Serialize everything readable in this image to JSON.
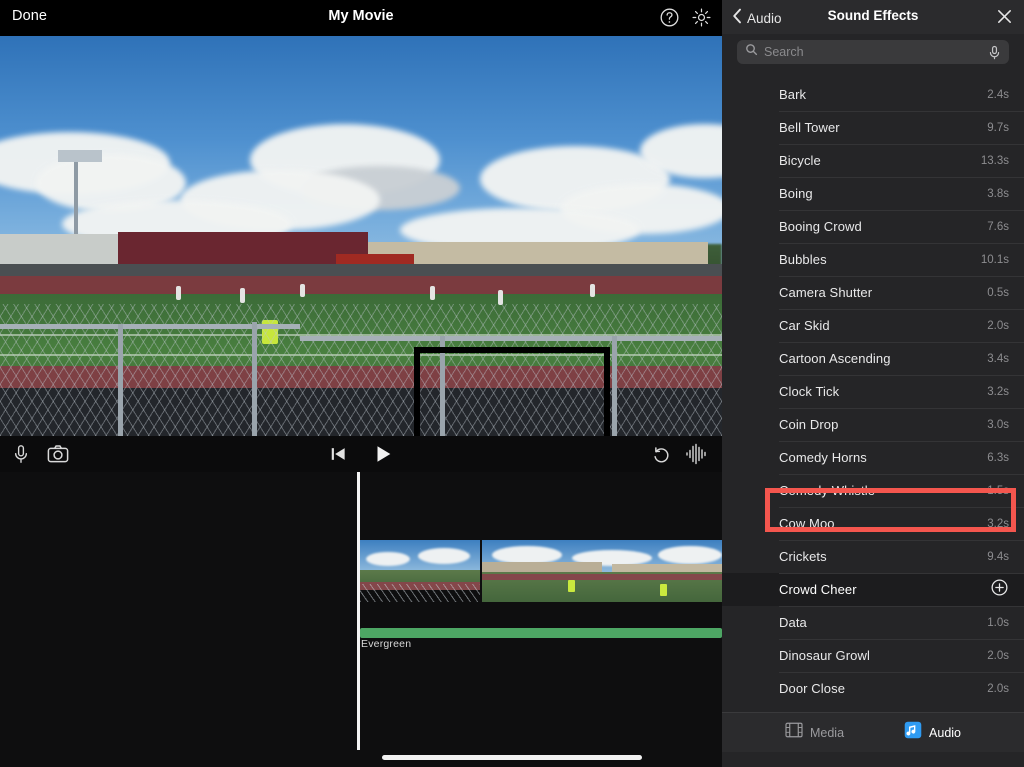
{
  "editor": {
    "toolbar": {
      "done_label": "Done",
      "project_title": "My Movie",
      "help_icon": "question-circle-icon",
      "settings_icon": "gear-icon"
    },
    "controls": {
      "mic_icon": "microphone-icon",
      "camera_icon": "camera-icon",
      "skip_start_icon": "skip-to-start-icon",
      "play_icon": "play-icon",
      "undo_icon": "undo-icon",
      "waveform_icon": "audio-waveform-icon"
    },
    "timeline": {
      "audio_track_label": "Evergreen",
      "audio_track_color": "#4da664",
      "playhead_color": "#f4f4f4"
    },
    "preview": {
      "annotation_box_color": "#000000"
    }
  },
  "panel": {
    "back_label": "Audio",
    "back_icon": "chevron-left-icon",
    "title": "Sound Effects",
    "close_icon": "close-icon",
    "search": {
      "placeholder": "Search",
      "value": "",
      "search_icon": "search-icon",
      "mic_icon": "microphone-icon"
    },
    "highlight_color": "#f4564e",
    "sound_effects": [
      {
        "name": "Bark",
        "duration": "2.4s"
      },
      {
        "name": "Bell Tower",
        "duration": "9.7s"
      },
      {
        "name": "Bicycle",
        "duration": "13.3s"
      },
      {
        "name": "Boing",
        "duration": "3.8s"
      },
      {
        "name": "Booing Crowd",
        "duration": "7.6s"
      },
      {
        "name": "Bubbles",
        "duration": "10.1s"
      },
      {
        "name": "Camera Shutter",
        "duration": "0.5s"
      },
      {
        "name": "Car Skid",
        "duration": "2.0s"
      },
      {
        "name": "Cartoon Ascending",
        "duration": "3.4s"
      },
      {
        "name": "Clock Tick",
        "duration": "3.2s"
      },
      {
        "name": "Coin Drop",
        "duration": "3.0s"
      },
      {
        "name": "Comedy Horns",
        "duration": "6.3s"
      },
      {
        "name": "Comedy Whistle",
        "duration": "1.5s"
      },
      {
        "name": "Cow Moo",
        "duration": "3.2s"
      },
      {
        "name": "Crickets",
        "duration": "9.4s"
      },
      {
        "name": "Crowd Cheer",
        "duration": "",
        "selected": true,
        "add_icon": "plus-circle-icon"
      },
      {
        "name": "Data",
        "duration": "1.0s"
      },
      {
        "name": "Dinosaur Growl",
        "duration": "2.0s"
      },
      {
        "name": "Door Close",
        "duration": "2.0s"
      }
    ],
    "tabs": [
      {
        "label": "Media",
        "icon": "film-icon",
        "active": false
      },
      {
        "label": "Audio",
        "icon": "music-note-icon",
        "active": true
      }
    ]
  }
}
